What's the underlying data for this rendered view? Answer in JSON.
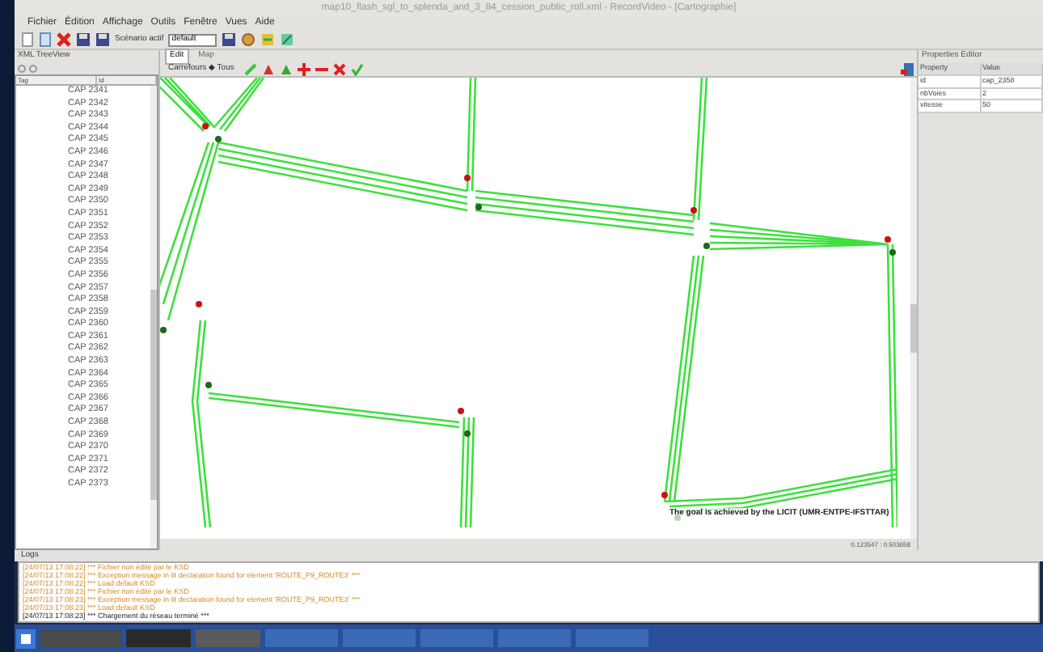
{
  "window": {
    "title": "map10_flash_sgl_to_splenda_and_3_84_cession_public_roll.xml - RecordVideo - [Cartographie]"
  },
  "menu": [
    "Fichier",
    "Édition",
    "Affichage",
    "Outils",
    "Fenêtre",
    "Vues",
    "Aide"
  ],
  "toolbar": {
    "scenario_label": "Scénario actif",
    "scenario_value": "default"
  },
  "tree_panel": {
    "title": "XML TreeView",
    "columns": [
      "Tag",
      "Id"
    ],
    "rows": [
      "CAP 2341",
      "CAP 2342",
      "CAP 2343",
      "CAP 2344",
      "CAP 2345",
      "CAP 2346",
      "CAP 2347",
      "CAP 2348",
      "CAP 2349",
      "CAP 2350",
      "CAP 2351",
      "CAP 2352",
      "CAP 2353",
      "CAP 2354",
      "CAP 2355",
      "CAP 2356",
      "CAP 2357",
      "CAP 2358",
      "CAP 2359",
      "CAP 2360",
      "CAP 2361",
      "CAP 2362",
      "CAP 2363",
      "CAP 2364",
      "CAP 2365",
      "CAP 2366",
      "CAP 2367",
      "CAP 2368",
      "CAP 2369",
      "CAP 2370",
      "CAP 2371",
      "CAP 2372",
      "CAP 2373"
    ]
  },
  "map_panel": {
    "tabs": [
      {
        "label": "Edit",
        "selected": true
      },
      {
        "label": "Map",
        "selected": false
      }
    ],
    "tool_label": "Carrefours ◆ Tous",
    "caption": "The goal is achieved by the LICIT (UMR-ENTPE-IFSTTAR)",
    "status": "0.123547 : 0.503658"
  },
  "properties_panel": {
    "title": "Properties Editor",
    "columns": [
      "Property",
      "Value"
    ],
    "rows": [
      [
        "id",
        "cap_2358"
      ],
      [
        "nbVoies",
        "2"
      ],
      [
        "vitesse",
        "50"
      ]
    ]
  },
  "log": {
    "title": "Logs",
    "lines": [
      {
        "kind": "warning",
        "text": "[24/07/13 17:08:22] *** Fichier non édité par le KSD"
      },
      {
        "kind": "warning",
        "text": "[24/07/13 17:08:22] *** Exception message in lit declaration found for element 'ROUTE_P9_ROUTE3' ***"
      },
      {
        "kind": "warning",
        "text": "[24/07/13 17:08:22] *** Load default KSD"
      },
      {
        "kind": "warning",
        "text": "[24/07/13 17:08:23] *** Fichier non édité par le KSD"
      },
      {
        "kind": "warning",
        "text": "[24/07/13 17:08:23] *** Exception message in lit declaration found for element 'ROUTE_P9_ROUTE3' ***"
      },
      {
        "kind": "warning",
        "text": "[24/07/13 17:08:23] *** Load default KSD"
      },
      {
        "kind": "info",
        "text": "[24/07/13 17:08:23] *** Chargement du réseau terminé ***"
      }
    ]
  }
}
